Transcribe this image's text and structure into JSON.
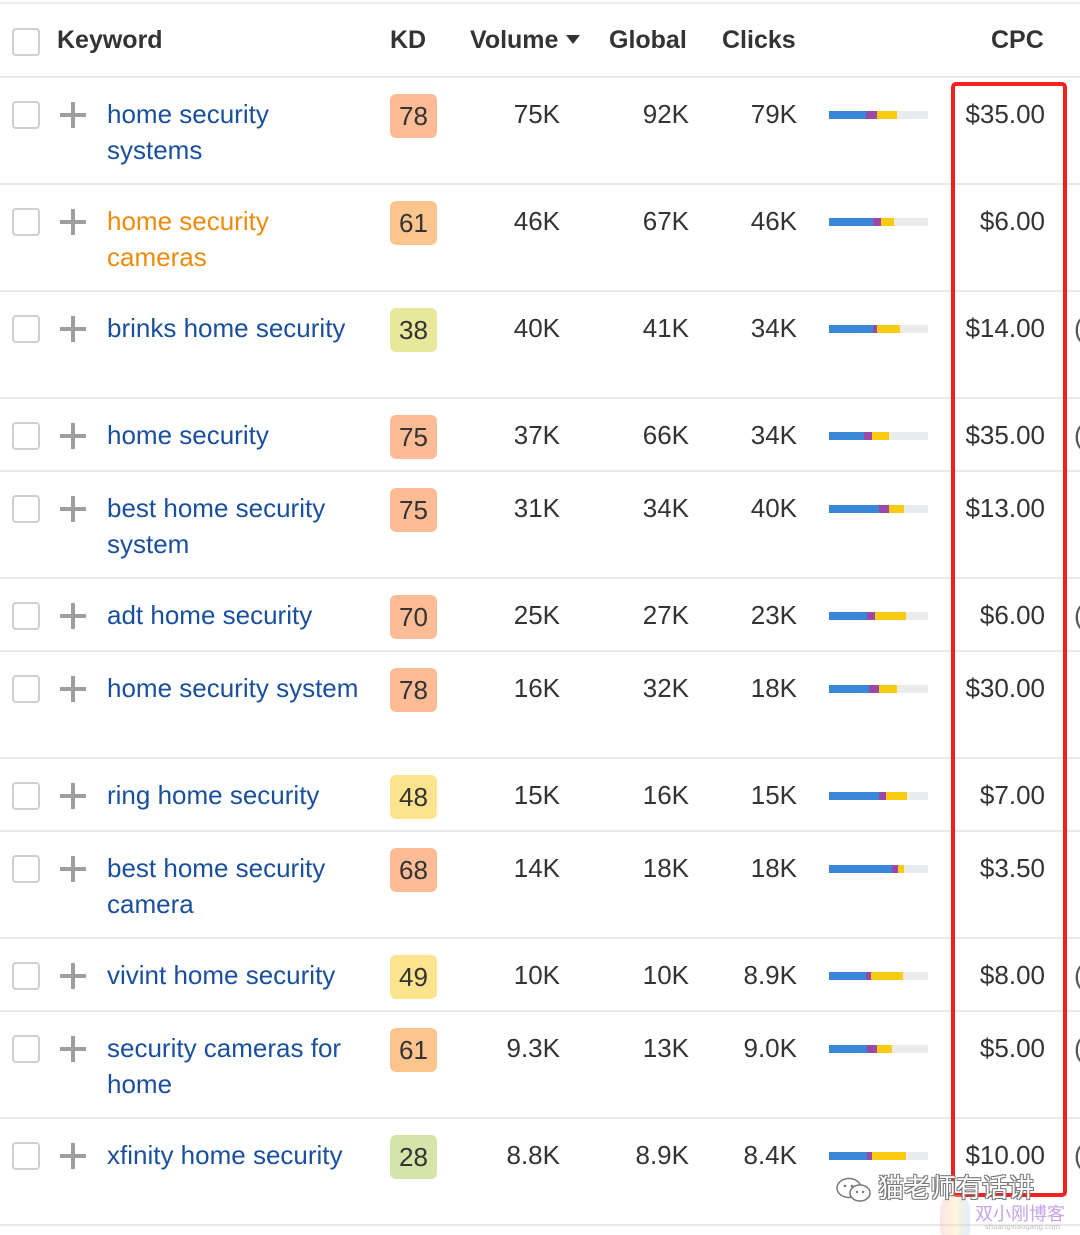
{
  "header": {
    "keyword": "Keyword",
    "kd": "KD",
    "volume": "Volume",
    "global": "Global",
    "clicks": "Clicks",
    "cpc": "CPC",
    "sort_icon": "sort-desc-icon"
  },
  "colors": {
    "link": "#1a4f9e",
    "link_visited": "#f08a0b",
    "highlight_border": "#f52121",
    "bar_blue": "#3a87d8",
    "bar_purple": "#9a4aa6",
    "bar_yellow": "#f9cb10",
    "bar_track": "#e9ebed"
  },
  "rows": [
    {
      "keyword": "home security systems",
      "visited": false,
      "kd": "78",
      "kd_color": "#fdbc95",
      "volume": "75K",
      "global": "92K",
      "clicks": "79K",
      "bar": {
        "blue": 0.37,
        "purple": 0.11,
        "yellow": 0.21
      },
      "cpc": "$35.00",
      "edge": ""
    },
    {
      "keyword": "home security cameras",
      "visited": true,
      "kd": "61",
      "kd_color": "#fdc58e",
      "volume": "46K",
      "global": "67K",
      "clicks": "46K",
      "bar": {
        "blue": 0.44,
        "purple": 0.09,
        "yellow": 0.13
      },
      "cpc": "$6.00",
      "edge": ""
    },
    {
      "keyword": "brinks home security",
      "visited": false,
      "kd": "38",
      "kd_color": "#e8e89a",
      "volume": "40K",
      "global": "41K",
      "clicks": "34K",
      "bar": {
        "blue": 0.44,
        "purple": 0.05,
        "yellow": 0.23
      },
      "cpc": "$14.00",
      "edge": "("
    },
    {
      "keyword": "home security",
      "visited": false,
      "kd": "75",
      "kd_color": "#fdbc95",
      "volume": "37K",
      "global": "66K",
      "clicks": "34K",
      "bar": {
        "blue": 0.35,
        "purple": 0.08,
        "yellow": 0.18
      },
      "cpc": "$35.00",
      "edge": "("
    },
    {
      "keyword": "best home security system",
      "visited": false,
      "kd": "75",
      "kd_color": "#fdbc95",
      "volume": "31K",
      "global": "34K",
      "clicks": "40K",
      "bar": {
        "blue": 0.51,
        "purple": 0.1,
        "yellow": 0.15
      },
      "cpc": "$13.00",
      "edge": ""
    },
    {
      "keyword": "adt home security",
      "visited": false,
      "kd": "70",
      "kd_color": "#fdbc95",
      "volume": "25K",
      "global": "27K",
      "clicks": "23K",
      "bar": {
        "blue": 0.38,
        "purple": 0.08,
        "yellow": 0.32
      },
      "cpc": "$6.00",
      "edge": "("
    },
    {
      "keyword": "home security system",
      "visited": false,
      "kd": "78",
      "kd_color": "#fdbc95",
      "volume": "16K",
      "global": "32K",
      "clicks": "18K",
      "bar": {
        "blue": 0.4,
        "purple": 0.11,
        "yellow": 0.18
      },
      "cpc": "$30.00",
      "edge": ""
    },
    {
      "keyword": "ring home security",
      "visited": false,
      "kd": "48",
      "kd_color": "#fbe48d",
      "volume": "15K",
      "global": "16K",
      "clicks": "15K",
      "bar": {
        "blue": 0.51,
        "purple": 0.07,
        "yellow": 0.21
      },
      "cpc": "$7.00",
      "edge": ""
    },
    {
      "keyword": "best home security camera",
      "visited": false,
      "kd": "68",
      "kd_color": "#fdbc95",
      "volume": "14K",
      "global": "18K",
      "clicks": "18K",
      "bar": {
        "blue": 0.64,
        "purple": 0.06,
        "yellow": 0.06
      },
      "cpc": "$3.50",
      "edge": ""
    },
    {
      "keyword": "vivint home security",
      "visited": false,
      "kd": "49",
      "kd_color": "#fbe48d",
      "volume": "10K",
      "global": "10K",
      "clicks": "8.9K",
      "bar": {
        "blue": 0.37,
        "purple": 0.05,
        "yellow": 0.33
      },
      "cpc": "$8.00",
      "edge": "("
    },
    {
      "keyword": "security cameras for home",
      "visited": false,
      "kd": "61",
      "kd_color": "#fdc58e",
      "volume": "9.3K",
      "global": "13K",
      "clicks": "9.0K",
      "bar": {
        "blue": 0.38,
        "purple": 0.11,
        "yellow": 0.15
      },
      "cpc": "$5.00",
      "edge": "("
    },
    {
      "keyword": "xfinity home security",
      "visited": false,
      "kd": "28",
      "kd_color": "#d3e5a8",
      "volume": "8.8K",
      "global": "8.9K",
      "clicks": "8.4K",
      "bar": {
        "blue": 0.38,
        "purple": 0.05,
        "yellow": 0.35
      },
      "cpc": "$10.00",
      "edge": "("
    }
  ],
  "watermark": {
    "line1": "猫老师有话讲",
    "line2": "双小刚博客",
    "line3": "shuangxiaogang.com"
  }
}
